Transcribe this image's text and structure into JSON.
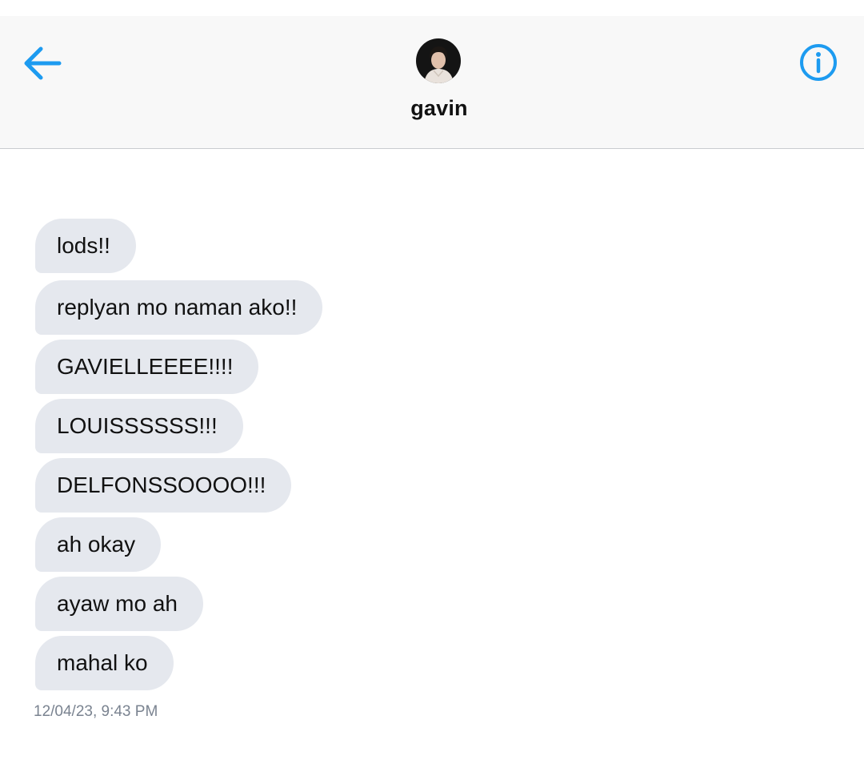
{
  "header": {
    "contact_name": "gavin",
    "back_icon": "arrow-left-icon",
    "info_icon": "info-circle-icon",
    "accent_color": "#1d9bf0"
  },
  "messages": [
    {
      "text": "lods!!"
    },
    {
      "text": "replyan mo naman ako!!"
    },
    {
      "text": "GAVIELLEEEE!!!!"
    },
    {
      "text": "LOUISSSSSS!!!"
    },
    {
      "text": "DELFONSSOOOO!!!"
    },
    {
      "text": "ah okay"
    },
    {
      "text": "ayaw mo ah"
    },
    {
      "text": "mahal ko"
    }
  ],
  "timestamp": "12/04/23, 9:43 PM",
  "colors": {
    "bubble_background": "#e5e8ee",
    "header_background": "#f8f8f8",
    "timestamp_text": "#7a8390"
  }
}
